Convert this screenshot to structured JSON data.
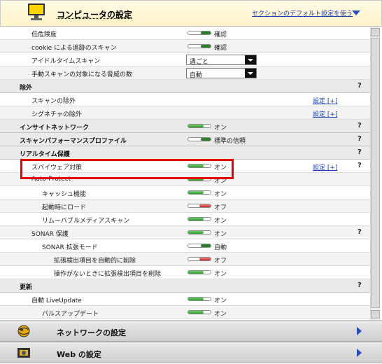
{
  "header": {
    "title": "コンピュータの設定",
    "default_link": "セクションのデフォルト設定を使う"
  },
  "rows": [
    {
      "type": "toggle",
      "label": "低危険度",
      "toggle": "on-dark",
      "state": "確認"
    },
    {
      "type": "toggle",
      "label": "cookie による追跡のスキャン",
      "toggle": "on-dark",
      "state": "確認"
    },
    {
      "type": "select",
      "label": "アイドルタイムスキャン",
      "value": "週ごと"
    },
    {
      "type": "select",
      "label": "手動スキャンの対象になる脅威の数",
      "value": "自動"
    },
    {
      "type": "section",
      "label": "除外",
      "help": "?"
    },
    {
      "type": "link",
      "label": "スキャンの除外",
      "link": "設定 [+]"
    },
    {
      "type": "link",
      "label": "シグネチャの除外",
      "link": "設定 [+]"
    },
    {
      "type": "section-toggle",
      "label": "インサイトネットワーク",
      "toggle": "on",
      "state": "オン",
      "help": "?"
    },
    {
      "type": "section-toggle",
      "label": "スキャンパフォーマンスプロファイル",
      "toggle": "on-dark",
      "state": "標準の信頼",
      "help": "?"
    },
    {
      "type": "section",
      "label": "リアルタイム保護",
      "help": "?"
    },
    {
      "type": "toggle",
      "label": "スパイウェア対策",
      "toggle": "on",
      "state": "オン",
      "link": "設定 [+]",
      "help": "?"
    },
    {
      "type": "toggle",
      "label": "Auto-Protect",
      "toggle": "on",
      "state": "オン"
    },
    {
      "type": "toggle",
      "label": "キャッシュ機能",
      "toggle": "on",
      "state": "オン"
    },
    {
      "type": "toggle",
      "label": "起動時にロード",
      "toggle": "off",
      "state": "オフ"
    },
    {
      "type": "toggle",
      "label": "リムーバブルメディアスキャン",
      "toggle": "on",
      "state": "オン"
    },
    {
      "type": "toggle",
      "label": "SONAR 保護",
      "toggle": "on",
      "state": "オン",
      "help": "?"
    },
    {
      "type": "toggle",
      "label": "SONAR 拡張モード",
      "toggle": "on-dark",
      "state": "自動"
    },
    {
      "type": "toggle",
      "label": "拡張検出項目を自動的に削除",
      "toggle": "off",
      "state": "オフ"
    },
    {
      "type": "toggle",
      "label": "操作がないときに拡張検出項目を削除",
      "toggle": "on",
      "state": "オン"
    },
    {
      "type": "section",
      "label": "更新",
      "help": "?"
    },
    {
      "type": "toggle",
      "label": "自動 LiveUpdate",
      "toggle": "on",
      "state": "オン"
    },
    {
      "type": "toggle",
      "label": "パルスアップデート",
      "toggle": "on",
      "state": "オン"
    }
  ],
  "bottom_nav": [
    {
      "label": "ネットワークの設定",
      "icon": "globe-network-icon"
    },
    {
      "label": "Web の設定",
      "icon": "web-film-icon"
    }
  ]
}
